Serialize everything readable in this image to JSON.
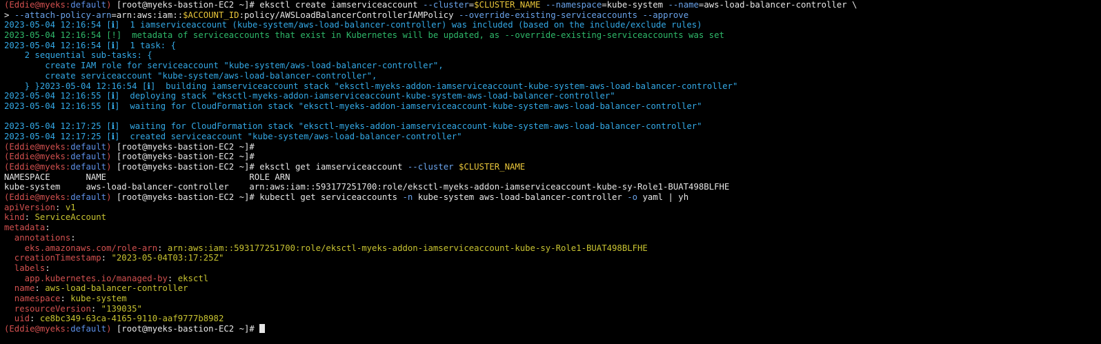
{
  "terminal": {
    "prompt": {
      "open": "(",
      "user": "Eddie@myeks",
      "sep": ":",
      "context": "default",
      "close": ")",
      "root": " [root@myeks-bastion-EC2 ~]# "
    },
    "colors": {
      "default": "#e6e6e6",
      "prompt_red": "#d2504f",
      "prompt_blue": "#5d8fe6",
      "log_blue": "#34a9e6",
      "log_green": "#2fb96a",
      "var_yellow": "#e8c53a",
      "yaml_key_red": "#d2504f",
      "yaml_value_yellow": "#c8c331",
      "cmd_flag_blue": "#6aa3ea"
    },
    "lines": [
      {
        "type": "prompt",
        "segments": [
          {
            "t": "eksctl create iamserviceaccount ",
            "c": "default"
          },
          {
            "t": "--cluster",
            "c": "cmd_flag_blue"
          },
          {
            "t": "=",
            "c": "default"
          },
          {
            "t": "$CLUSTER_NAME",
            "c": "var_yellow"
          },
          {
            "t": " ",
            "c": "default"
          },
          {
            "t": "--namespace",
            "c": "cmd_flag_blue"
          },
          {
            "t": "=kube-system ",
            "c": "default"
          },
          {
            "t": "--name",
            "c": "cmd_flag_blue"
          },
          {
            "t": "=aws-load-balancer-controller \\",
            "c": "default"
          }
        ]
      },
      {
        "type": "plain",
        "segments": [
          {
            "t": "> ",
            "c": "default"
          },
          {
            "t": "--attach-policy-arn",
            "c": "cmd_flag_blue"
          },
          {
            "t": "=arn:aws:iam::",
            "c": "default"
          },
          {
            "t": "$ACCOUNT_ID",
            "c": "var_yellow"
          },
          {
            "t": ":policy/AWSLoadBalancerControllerIAMPolicy ",
            "c": "default"
          },
          {
            "t": "--override-existing-serviceaccounts",
            "c": "cmd_flag_blue"
          },
          {
            "t": " ",
            "c": "default"
          },
          {
            "t": "--approve",
            "c": "cmd_flag_blue"
          }
        ]
      },
      {
        "type": "plain",
        "segments": [
          {
            "t": "2023-05-04 12:16:54 [ℹ]  1 iamserviceaccount (kube-system/aws-load-balancer-controller) was included (based on the include/exclude rules)",
            "c": "log_blue"
          }
        ]
      },
      {
        "type": "plain",
        "segments": [
          {
            "t": "2023-05-04 12:16:54 [!]  metadata of serviceaccounts that exist in Kubernetes will be updated, as --override-existing-serviceaccounts was set",
            "c": "log_green"
          }
        ]
      },
      {
        "type": "plain",
        "segments": [
          {
            "t": "2023-05-04 12:16:54 [ℹ]  1 task: {",
            "c": "log_blue"
          }
        ]
      },
      {
        "type": "plain",
        "segments": [
          {
            "t": "    2 sequential sub-tasks: {",
            "c": "log_blue"
          }
        ]
      },
      {
        "type": "plain",
        "segments": [
          {
            "t": "        create IAM role for serviceaccount \"kube-system/aws-load-balancer-controller\",",
            "c": "log_blue"
          }
        ]
      },
      {
        "type": "plain",
        "segments": [
          {
            "t": "        create serviceaccount \"kube-system/aws-load-balancer-controller\",",
            "c": "log_blue"
          }
        ]
      },
      {
        "type": "plain",
        "segments": [
          {
            "t": "    } }2023-05-04 12:16:54 [ℹ]  building iamserviceaccount stack \"eksctl-myeks-addon-iamserviceaccount-kube-system-aws-load-balancer-controller\"",
            "c": "log_blue"
          }
        ]
      },
      {
        "type": "plain",
        "segments": [
          {
            "t": "2023-05-04 12:16:55 [ℹ]  deploying stack \"eksctl-myeks-addon-iamserviceaccount-kube-system-aws-load-balancer-controller\"",
            "c": "log_blue"
          }
        ]
      },
      {
        "type": "plain",
        "segments": [
          {
            "t": "2023-05-04 12:16:55 [ℹ]  waiting for CloudFormation stack \"eksctl-myeks-addon-iamserviceaccount-kube-system-aws-load-balancer-controller\"",
            "c": "log_blue"
          }
        ]
      },
      {
        "type": "blank",
        "segments": []
      },
      {
        "type": "plain",
        "segments": [
          {
            "t": "2023-05-04 12:17:25 [ℹ]  waiting for CloudFormation stack \"eksctl-myeks-addon-iamserviceaccount-kube-system-aws-load-balancer-controller\"",
            "c": "log_blue"
          }
        ]
      },
      {
        "type": "plain",
        "segments": [
          {
            "t": "2023-05-04 12:17:25 [ℹ]  created serviceaccount \"kube-system/aws-load-balancer-controller\"",
            "c": "log_blue"
          }
        ]
      },
      {
        "type": "prompt",
        "segments": []
      },
      {
        "type": "prompt",
        "segments": []
      },
      {
        "type": "prompt",
        "segments": [
          {
            "t": "eksctl get iamserviceaccount ",
            "c": "default"
          },
          {
            "t": "--cluster",
            "c": "cmd_flag_blue"
          },
          {
            "t": " ",
            "c": "default"
          },
          {
            "t": "$CLUSTER_NAME",
            "c": "var_yellow"
          }
        ]
      },
      {
        "type": "plain",
        "segments": [
          {
            "t": "NAMESPACE       NAME                            ROLE ARN",
            "c": "default"
          }
        ]
      },
      {
        "type": "plain",
        "segments": [
          {
            "t": "kube-system     aws-load-balancer-controller    arn:aws:iam::593177251700:role/eksctl-myeks-addon-iamserviceaccount-kube-sy-Role1-BUAT498BLFHE",
            "c": "default"
          }
        ]
      },
      {
        "type": "prompt",
        "segments": [
          {
            "t": "kubectl get serviceaccounts ",
            "c": "default"
          },
          {
            "t": "-n",
            "c": "cmd_flag_blue"
          },
          {
            "t": " kube-system aws-load-balancer-controller ",
            "c": "default"
          },
          {
            "t": "-o",
            "c": "cmd_flag_blue"
          },
          {
            "t": " yaml | yh",
            "c": "default"
          }
        ]
      },
      {
        "type": "plain",
        "segments": [
          {
            "t": "apiVersion",
            "c": "yaml_key_red"
          },
          {
            "t": ": ",
            "c": "default"
          },
          {
            "t": "v1",
            "c": "yaml_value_yellow"
          }
        ]
      },
      {
        "type": "plain",
        "segments": [
          {
            "t": "kind",
            "c": "yaml_key_red"
          },
          {
            "t": ": ",
            "c": "default"
          },
          {
            "t": "ServiceAccount",
            "c": "yaml_value_yellow"
          }
        ]
      },
      {
        "type": "plain",
        "segments": [
          {
            "t": "metadata",
            "c": "yaml_key_red"
          },
          {
            "t": ":",
            "c": "default"
          }
        ]
      },
      {
        "type": "plain",
        "segments": [
          {
            "t": "  annotations",
            "c": "yaml_key_red"
          },
          {
            "t": ":",
            "c": "default"
          }
        ]
      },
      {
        "type": "plain",
        "segments": [
          {
            "t": "    eks.amazonaws.com/role-arn",
            "c": "yaml_key_red"
          },
          {
            "t": ": ",
            "c": "default"
          },
          {
            "t": "arn:aws:iam::593177251700:role/eksctl-myeks-addon-iamserviceaccount-kube-sy-Role1-BUAT498BLFHE",
            "c": "yaml_value_yellow"
          }
        ]
      },
      {
        "type": "plain",
        "segments": [
          {
            "t": "  creationTimestamp",
            "c": "yaml_key_red"
          },
          {
            "t": ": ",
            "c": "default"
          },
          {
            "t": "\"2023-05-04T03:17:25Z\"",
            "c": "yaml_value_yellow"
          }
        ]
      },
      {
        "type": "plain",
        "segments": [
          {
            "t": "  labels",
            "c": "yaml_key_red"
          },
          {
            "t": ":",
            "c": "default"
          }
        ]
      },
      {
        "type": "plain",
        "segments": [
          {
            "t": "    app.kubernetes.io/managed-by",
            "c": "yaml_key_red"
          },
          {
            "t": ": ",
            "c": "default"
          },
          {
            "t": "eksctl",
            "c": "yaml_value_yellow"
          }
        ]
      },
      {
        "type": "plain",
        "segments": [
          {
            "t": "  name",
            "c": "yaml_key_red"
          },
          {
            "t": ": ",
            "c": "default"
          },
          {
            "t": "aws-load-balancer-controller",
            "c": "yaml_value_yellow"
          }
        ]
      },
      {
        "type": "plain",
        "segments": [
          {
            "t": "  namespace",
            "c": "yaml_key_red"
          },
          {
            "t": ": ",
            "c": "default"
          },
          {
            "t": "kube-system",
            "c": "yaml_value_yellow"
          }
        ]
      },
      {
        "type": "plain",
        "segments": [
          {
            "t": "  resourceVersion",
            "c": "yaml_key_red"
          },
          {
            "t": ": ",
            "c": "default"
          },
          {
            "t": "\"139035\"",
            "c": "yaml_value_yellow"
          }
        ]
      },
      {
        "type": "plain",
        "segments": [
          {
            "t": "  uid",
            "c": "yaml_key_red"
          },
          {
            "t": ": ",
            "c": "default"
          },
          {
            "t": "ce8bc349-63ca-4165-9110-aaf9777b8982",
            "c": "yaml_value_yellow"
          }
        ]
      },
      {
        "type": "prompt_cursor",
        "segments": []
      }
    ]
  }
}
